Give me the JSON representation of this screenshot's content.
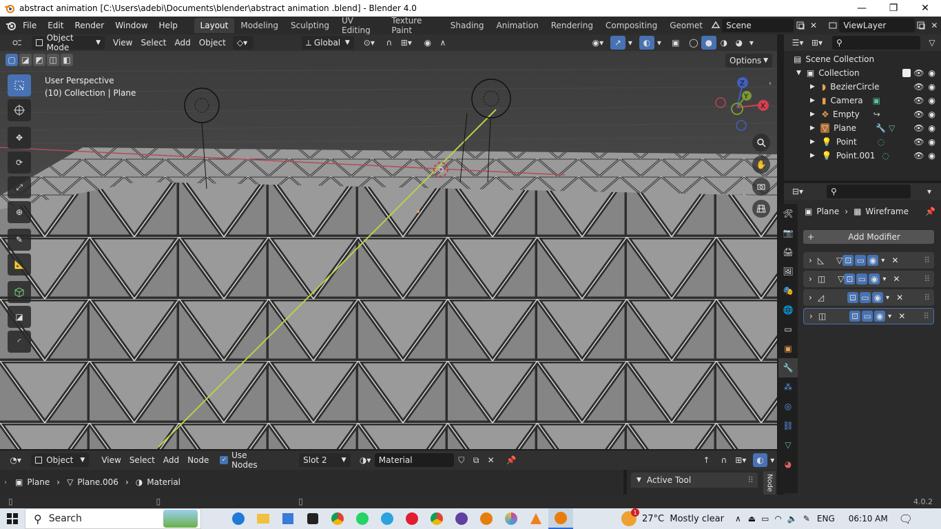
{
  "window": {
    "title": "abstract animation  [C:\\Users\\adebi\\Documents\\blender\\abstract animation .blend] - Blender 4.0",
    "minimize": "—",
    "maximize": "❐",
    "close": "✕"
  },
  "menu": {
    "items": [
      "File",
      "Edit",
      "Render",
      "Window",
      "Help"
    ]
  },
  "workspaces": {
    "tabs": [
      "Layout",
      "Modeling",
      "Sculpting",
      "UV Editing",
      "Texture Paint",
      "Shading",
      "Animation",
      "Rendering",
      "Compositing",
      "Geomet"
    ],
    "active": "Layout"
  },
  "scene": {
    "name": "Scene"
  },
  "viewlayer": {
    "name": "ViewLayer"
  },
  "viewport_header": {
    "mode": "Object Mode",
    "menus": [
      "View",
      "Select",
      "Add",
      "Object"
    ],
    "orientation": "Global",
    "options_label": "Options"
  },
  "viewport": {
    "perspective": "User Perspective",
    "collection_info": "(10) Collection | Plane",
    "gizmo": {
      "x": "X",
      "y": "Y",
      "z": "Z"
    }
  },
  "outliner": {
    "root": "Scene Collection",
    "collection": "Collection",
    "items": [
      "BezierCircle",
      "Camera",
      "Empty",
      "Plane",
      "Point",
      "Point.001"
    ]
  },
  "properties": {
    "breadcrumb_object": "Plane",
    "breadcrumb_modifier": "Wireframe",
    "add_modifier": "Add Modifier"
  },
  "node_header": {
    "editor_mode": "Object",
    "menus": [
      "View",
      "Select",
      "Add",
      "Node"
    ],
    "use_nodes_label": "Use Nodes",
    "use_nodes_checked": true,
    "slot": "Slot 2",
    "material": "Material"
  },
  "node_breadcrumb": {
    "object": "Plane",
    "mesh": "Plane.006",
    "material": "Material"
  },
  "side_panel": {
    "active_tool": "Active Tool",
    "tab_label": "Node"
  },
  "status": {
    "version": "4.0.2"
  },
  "taskbar": {
    "search_label": "Search",
    "weather": "27°C  Mostly clear",
    "language": "ENG",
    "time": "06:10 AM",
    "weather_badge": "1"
  },
  "colors": {
    "accent": "#4772b3",
    "active_yellow": "#c8e05a",
    "orange": "#e8a050"
  }
}
